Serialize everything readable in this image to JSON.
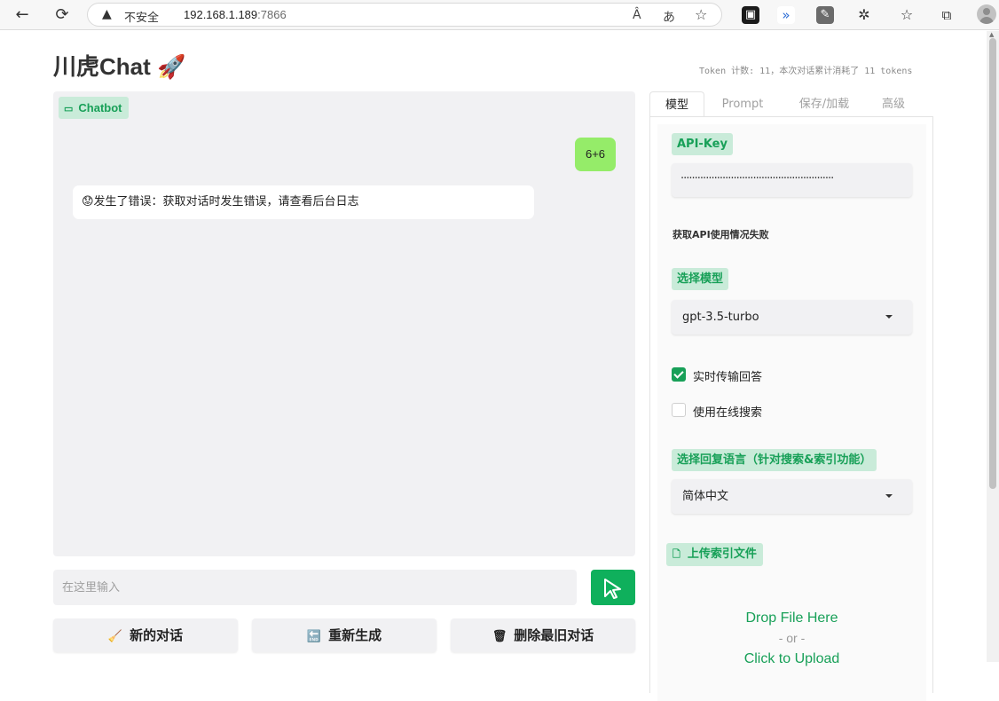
{
  "browser": {
    "back_icon": "←",
    "reload_icon": "⟳",
    "warning_icon": "▲",
    "insecure_label": "不安全",
    "url_host": "192.168.1.189",
    "url_port": ":7866",
    "read_aloud_icon": "Â",
    "translate_icon": "あ",
    "favorite_icon": "☆"
  },
  "app": {
    "title": "川虎Chat 🚀",
    "token_info": "Token 计数: 11，本次对话累计消耗了 11 tokens"
  },
  "chatbot": {
    "label": "Chatbot",
    "messages": [
      {
        "role": "user",
        "text": "6+6"
      },
      {
        "role": "bot",
        "text": "😟发生了错误：获取对话时发生错误，请查看后台日志"
      }
    ]
  },
  "input": {
    "placeholder": "在这里输入"
  },
  "actions": {
    "new_chat": {
      "icon": "🧹",
      "label": "新的对话"
    },
    "regenerate": {
      "icon": "🔚",
      "label": "重新生成"
    },
    "delete_last": {
      "icon": "🗑",
      "label": "删除最旧对话"
    }
  },
  "tabs": [
    "模型",
    "Prompt",
    "保存/加载",
    "高级"
  ],
  "settings": {
    "api_key_label": "API-Key",
    "api_key_value": "·······················································",
    "usage_status": "获取API使用情况失败",
    "model_label": "选择模型",
    "model_value": "gpt-3.5-turbo",
    "stream_label": "实时传输回答",
    "stream_checked": true,
    "online_search_label": "使用在线搜索",
    "online_search_checked": false,
    "reply_lang_label": "选择回复语言（针对搜索&索引功能）",
    "reply_lang_value": "简体中文",
    "upload_label": "上传索引文件",
    "drop_text": "Drop File Here",
    "or_text": "- or -",
    "click_text": "Click to Upload"
  },
  "colors": {
    "accent": "#18a058",
    "send_button": "#0fb05c",
    "user_bubble": "#95ec69",
    "label_bg": "#c9ebd9"
  }
}
